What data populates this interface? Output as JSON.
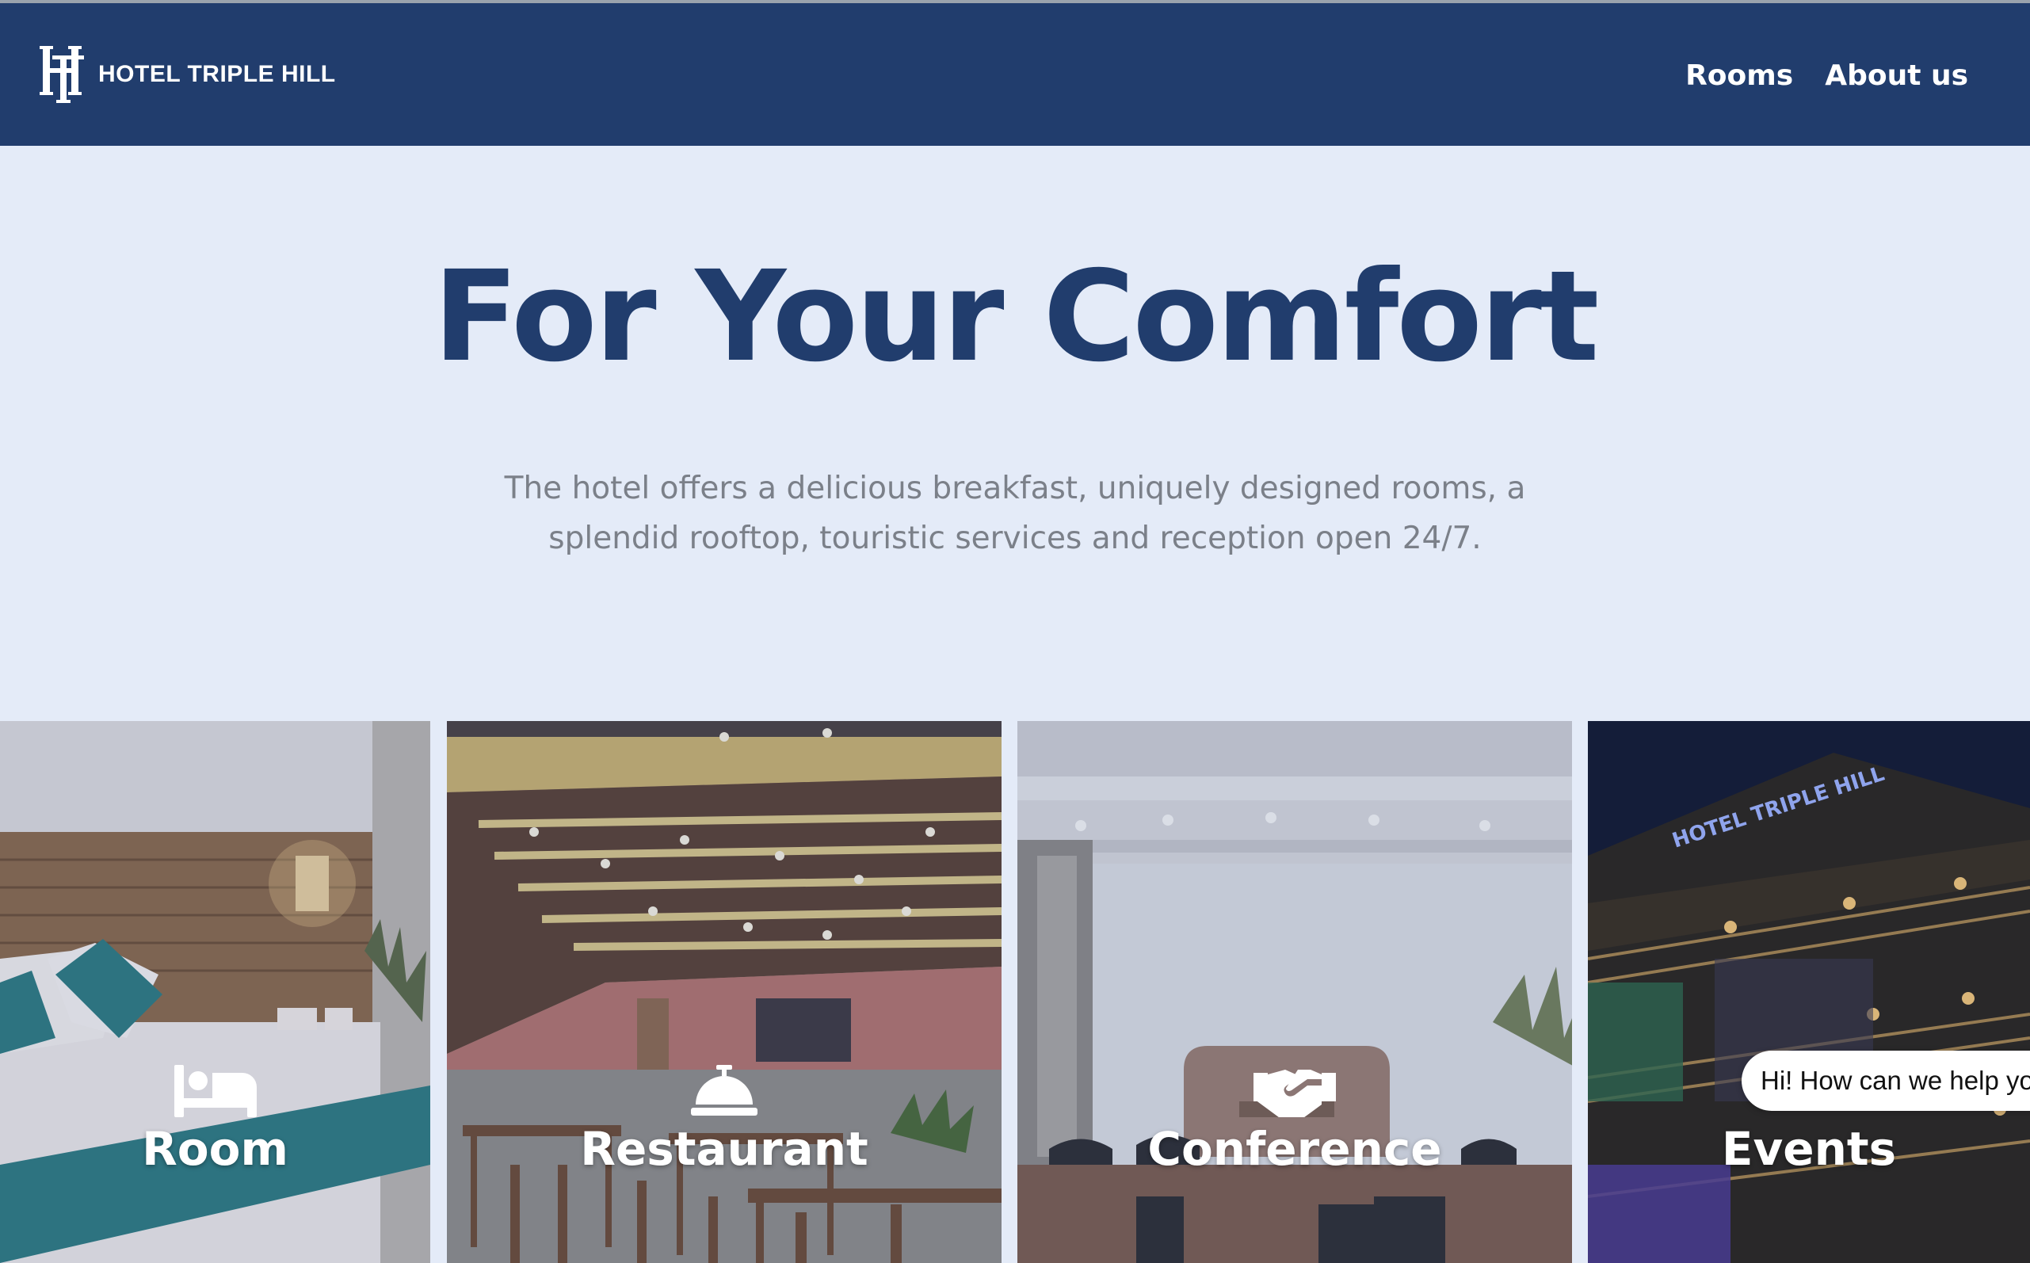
{
  "header": {
    "brand_name": "HOTEL TRIPLE HILL",
    "nav": [
      {
        "label": "Rooms"
      },
      {
        "label": "About us"
      }
    ]
  },
  "hero": {
    "title": "For Your Comfort",
    "subtitle": "The hotel offers a delicious breakfast, uniquely designed rooms, a splendid rooftop, touristic services and reception open 24/7."
  },
  "services": [
    {
      "label": "Room",
      "icon": "bed-icon"
    },
    {
      "label": "Restaurant",
      "icon": "service-bell-icon"
    },
    {
      "label": "Conference",
      "icon": "handshake-icon"
    },
    {
      "label": "Events",
      "icon": "events-icon"
    }
  ],
  "chat": {
    "greeting": "Hi! How can we help you?"
  },
  "colors": {
    "navbar": "#213d6d",
    "page_background": "#e4ebf8",
    "title": "#213d6d",
    "subtitle": "#7b8089"
  }
}
